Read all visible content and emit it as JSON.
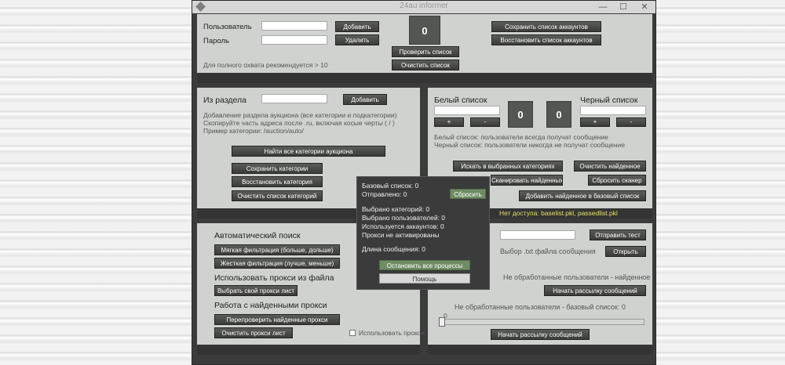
{
  "window": {
    "title": "24au informer",
    "min": "—",
    "max": "☐",
    "close": "✕"
  },
  "accounts": {
    "user_label": "Пользователь",
    "password_label": "Пароль",
    "add": "Добавить",
    "remove": "Удалить",
    "counter": "0",
    "check_list": "Проверить список",
    "clear_list": "Очистить список",
    "save_accounts": "Сохранить список аккаунтов",
    "restore_accounts": "Восстановить список аккаунтов",
    "hint": "Для полного охвата рекомендуется > 10"
  },
  "sections": {
    "from_section_label": "Из раздела",
    "add": "Добавить",
    "hint1": "Добавление раздела аукциона (все категории и подкатегории)",
    "hint2": "Скопируйте часть адреса после .ru, включая косые черты ( / )",
    "hint3": "Пример категории: /auction/auto/",
    "find_all": "Найти все категории аукциона",
    "save": "Сохранить категории",
    "restore": "Восстановить категория",
    "clear": "Очистить список категорий"
  },
  "lists": {
    "white_label": "Белый список",
    "black_label": "Черный список",
    "plus": "+",
    "minus": "-",
    "white_count": "0",
    "black_count": "0",
    "white_hint": "Белый список: пользователи всегда получат сообщение",
    "black_hint": "Черный список: пользователи никогда не получат сообщение",
    "search_selected": "Искать в выбранных категориях",
    "clear_found": "Очистить найденное",
    "scan_found": "Сканировать найденных",
    "reset_scanner": "Сбросить сканер",
    "add_found_to_base": "Добавить найденное в базовый список",
    "no_access": "Нет доступа: baselist.pkl, passedlist.pkl"
  },
  "auto_search": {
    "header": "Автоматический поиск",
    "soft": "Мягкая фильтрация (больше, дольше)",
    "hard": "Жесткая фильтрация (лучше, меньше)",
    "proxy_header": "Использовать прокси из файла",
    "choose_proxy": "Выбрать свой прокси лист",
    "found_proxy_header": "Работа с найденными прокси",
    "recheck_proxy": "Перепроверить найденные прокси",
    "clear_proxy": "Очистить прокси лист",
    "use_proxy": "Использовать прокси"
  },
  "messaging": {
    "send_test": "Отправить тест",
    "choose_txt": "Выбор .txt файла сообщения",
    "open": "Открыть",
    "unprocessed_found": "Не обработанные пользователи - найденное",
    "start_mailing": "Начать рассылку сообщений",
    "unprocessed_base": "Не обработанные пользователи - базовый список: 0",
    "slider_value": "0",
    "slider_fraction": 0
  },
  "popup": {
    "base_list": "Базовый список: 0",
    "sent": "Отправлено: 0",
    "reset": "Сбросить",
    "categories_selected": "Выбрано категорий: 0",
    "users_selected": "Выбрано пользователей: 0",
    "accounts_used": "Используется аккаунтов: 0",
    "proxy_inactive": "Прокси не активированы",
    "message_length": "Длина сообщения: 0",
    "stop_all": "Остановить все процессы",
    "help": "Помощь"
  },
  "colors": {
    "panel": "#cfd2cf",
    "dark": "#333433",
    "button": "#4a4c49",
    "accent_green": "#6f8c64",
    "warning_yellow": "#e6e16a"
  }
}
